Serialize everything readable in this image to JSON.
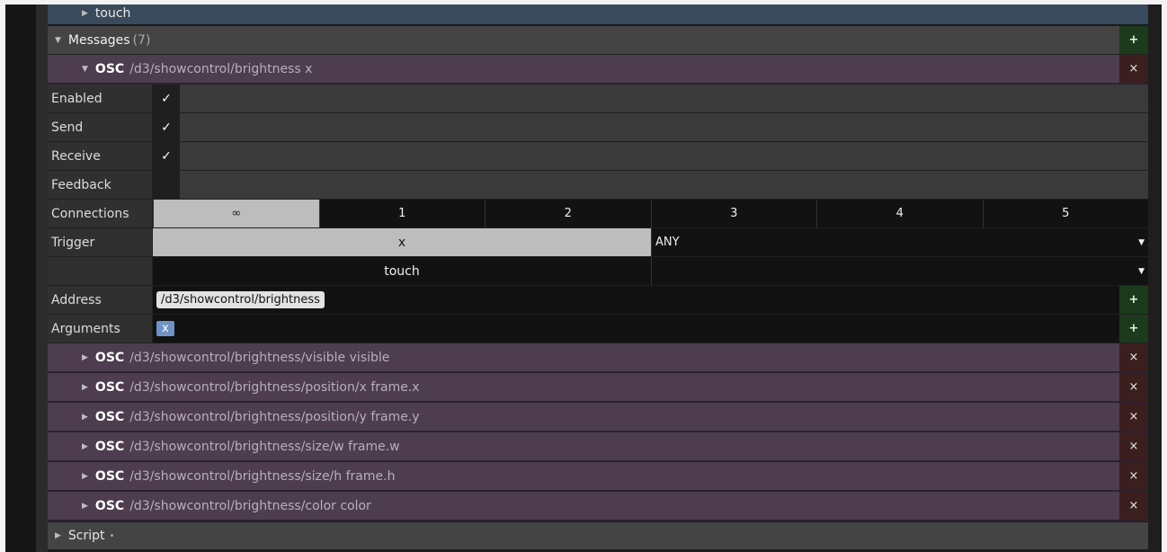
{
  "tree": {
    "touch_label": "touch",
    "messages_label": "Messages",
    "messages_count": "(7)",
    "add_symbol": "+",
    "close_symbol": "×",
    "expanded_message": {
      "kind": "OSC",
      "address_text": "/d3/showcontrol/brightness x"
    },
    "params": {
      "enabled_label": "Enabled",
      "send_label": "Send",
      "receive_label": "Receive",
      "feedback_label": "Feedback",
      "connections_label": "Connections",
      "trigger_label": "Trigger",
      "address_label": "Address",
      "arguments_label": "Arguments",
      "check_glyph": "✓",
      "connections": [
        "∞",
        "1",
        "2",
        "3",
        "4",
        "5"
      ],
      "trigger_value": "x",
      "trigger_mode": "ANY",
      "trigger_value2": "touch",
      "address_value": "/d3/showcontrol/brightness",
      "argument_value": "x"
    },
    "collapsed_messages": [
      {
        "kind": "OSC",
        "address_text": "/d3/showcontrol/brightness/visible visible"
      },
      {
        "kind": "OSC",
        "address_text": "/d3/showcontrol/brightness/position/x frame.x"
      },
      {
        "kind": "OSC",
        "address_text": "/d3/showcontrol/brightness/position/y frame.y"
      },
      {
        "kind": "OSC",
        "address_text": "/d3/showcontrol/brightness/size/w frame.w"
      },
      {
        "kind": "OSC",
        "address_text": "/d3/showcontrol/brightness/size/h frame.h"
      },
      {
        "kind": "OSC",
        "address_text": "/d3/showcontrol/brightness/color color"
      }
    ],
    "script_label": "Script"
  },
  "colors": {
    "osc_row": "#4d3d4e",
    "messages_header": "#444444",
    "touch_header": "#394a5c",
    "selected_cell": "#bdbdbd",
    "argument_pill": "#6e93c6"
  }
}
